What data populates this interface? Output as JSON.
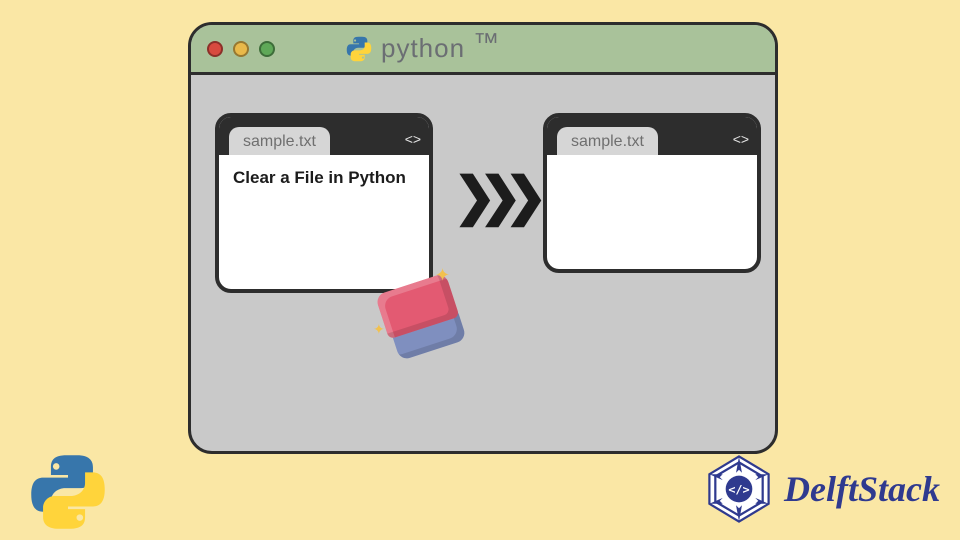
{
  "titlebar": {
    "python_label": "python",
    "tm": "™"
  },
  "files": {
    "left": {
      "tab_label": "sample.txt",
      "tab_icons": "< >",
      "content": "Clear a File in Python"
    },
    "right": {
      "tab_label": "sample.txt",
      "tab_icons": "< >",
      "content": ""
    }
  },
  "arrows": "❯❯❯",
  "sparkle": "✦",
  "footer": {
    "brand": "DelftStack"
  },
  "colors": {
    "bg": "#fae7a5",
    "window_border": "#2d2d2d",
    "titlebar": "#a9c29a",
    "brand_blue": "#2f3a8f",
    "eraser_top": "#e35a72",
    "eraser_bottom": "#7f8fbf"
  }
}
